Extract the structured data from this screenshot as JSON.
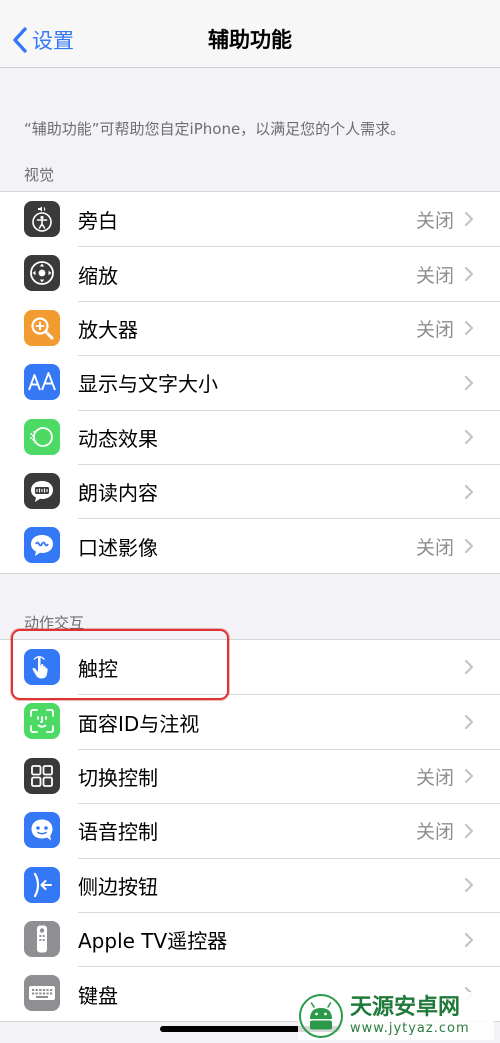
{
  "nav": {
    "back_label": "设置",
    "title": "辅助功能"
  },
  "description": "“辅助功能”可帮助您自定iPhone，以满足您的个人需求。",
  "sections": [
    {
      "header": "视觉",
      "rows": [
        {
          "label": "旁白",
          "value": "关闭",
          "icon": "voiceover-icon",
          "color": "#3a3a3c"
        },
        {
          "label": "缩放",
          "value": "关闭",
          "icon": "zoom-icon",
          "color": "#3a3a3c"
        },
        {
          "label": "放大器",
          "value": "关闭",
          "icon": "magnifier-icon",
          "color": "#f29b30"
        },
        {
          "label": "显示与文字大小",
          "value": "",
          "icon": "text-size-icon",
          "color": "#3478f6"
        },
        {
          "label": "动态效果",
          "value": "",
          "icon": "motion-icon",
          "color": "#4cd964"
        },
        {
          "label": "朗读内容",
          "value": "",
          "icon": "spoken-content-icon",
          "color": "#3a3a3c"
        },
        {
          "label": "口述影像",
          "value": "关闭",
          "icon": "audio-description-icon",
          "color": "#3478f6"
        }
      ]
    },
    {
      "header": "动作交互",
      "rows": [
        {
          "label": "触控",
          "value": "",
          "icon": "touch-icon",
          "color": "#3478f6"
        },
        {
          "label": "面容ID与注视",
          "value": "",
          "icon": "face-id-icon",
          "color": "#4cd964"
        },
        {
          "label": "切换控制",
          "value": "关闭",
          "icon": "switch-control-icon",
          "color": "#3a3a3c"
        },
        {
          "label": "语音控制",
          "value": "关闭",
          "icon": "voice-control-icon",
          "color": "#3478f6"
        },
        {
          "label": "侧边按钮",
          "value": "",
          "icon": "side-button-icon",
          "color": "#3478f6"
        },
        {
          "label": "Apple TV遥控器",
          "value": "",
          "icon": "apple-tv-remote-icon",
          "color": "#8e8e93"
        },
        {
          "label": "键盘",
          "value": "",
          "icon": "keyboard-icon",
          "color": "#8e8e93"
        }
      ]
    }
  ],
  "watermark": {
    "title": "天源安卓网",
    "url": "www.jytyaz.com"
  },
  "colors": {
    "accent": "#3478f6",
    "highlight": "#dd3333",
    "watermark": "#1f7a3a"
  }
}
